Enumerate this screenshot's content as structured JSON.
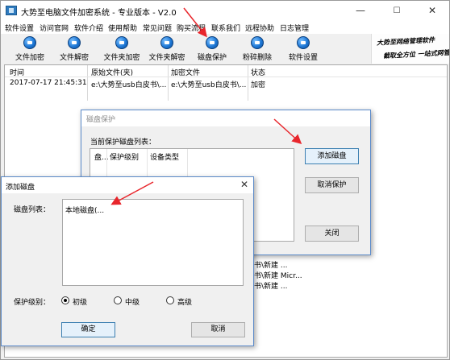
{
  "window": {
    "title": "大势至电脑文件加密系统 - 专业版本 - V2.0",
    "controls": {
      "minimize": "—",
      "maximize": "☐",
      "close": "✕"
    }
  },
  "menu": {
    "items": [
      "软件设置",
      "访问官网",
      "软件介绍",
      "使用帮助",
      "常见问题",
      "购买流程",
      "联系我们",
      "远程协助",
      "日志管理"
    ]
  },
  "toolbar": {
    "items": [
      "文件加密",
      "文件解密",
      "文件夹加密",
      "文件夹解密",
      "磁盘保护",
      "粉碎删除",
      "软件设置"
    ]
  },
  "banner": {
    "line1": "大势至网络管理软件",
    "line2": "截取全方位 一站式网管"
  },
  "filelist": {
    "columns": [
      "时间",
      "原始文件(夹)",
      "加密文件",
      "状态"
    ],
    "row": {
      "time": "2017-07-17 21:45:31",
      "original": "e:\\大势至usb白皮书\\...",
      "encrypted": "e:\\大势至usb白皮书\\...",
      "status": "加密"
    },
    "bg_lines": [
      "书\\新建 ...",
      "书\\新建 Micr...",
      "书\\新建 ..."
    ]
  },
  "protect_dialog": {
    "title": "磁盘保护",
    "list_label": "当前保护磁盘列表：",
    "columns": [
      "盘...",
      "保护级别",
      "设备类型"
    ],
    "buttons": {
      "add": "添加磁盘",
      "cancel": "取消保护",
      "close": "关闭"
    }
  },
  "add_dialog": {
    "title": "添加磁盘",
    "close_icon": "✕",
    "list_label": "磁盘列表：",
    "list_items": [
      "本地磁盘(..."
    ],
    "level_label": "保护级别：",
    "levels": [
      "初级",
      "中级",
      "高级"
    ],
    "selected_level": "初级",
    "buttons": {
      "ok": "确定",
      "cancel": "取消"
    }
  },
  "colors": {
    "accent": "#1e78d6",
    "arrow": "#e8262c",
    "window_border": "#5b8ac9"
  }
}
